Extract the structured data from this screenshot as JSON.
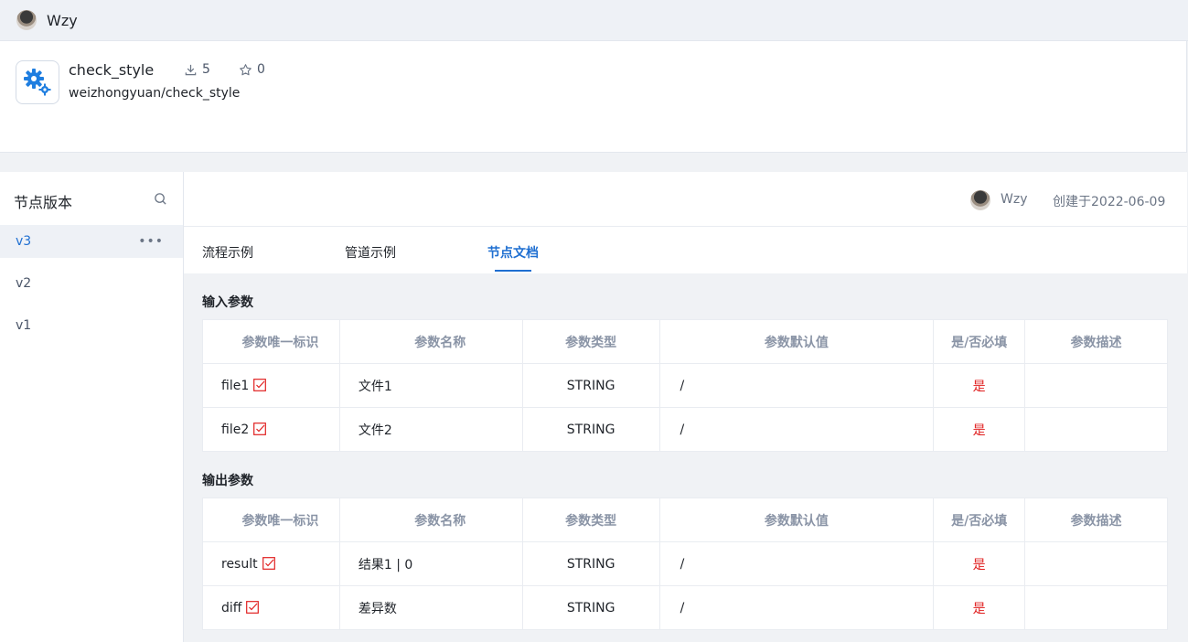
{
  "topbar": {
    "user_name": "Wzy"
  },
  "node": {
    "name": "check_style",
    "path": "weizhongyuan/check_style",
    "downloads": "5",
    "stars": "0",
    "icon": "gear-icon"
  },
  "sidebar": {
    "title": "节点版本",
    "versions": [
      {
        "label": "v3",
        "active": true
      },
      {
        "label": "v2"
      },
      {
        "label": "v1"
      }
    ]
  },
  "meta": {
    "user": "Wzy",
    "created": "创建于2022-06-09"
  },
  "tabs": [
    {
      "label": "流程示例"
    },
    {
      "label": "管道示例"
    },
    {
      "label": "节点文档",
      "active": true
    }
  ],
  "columns": [
    "参数唯一标识",
    "参数名称",
    "参数类型",
    "参数默认值",
    "是/否必填",
    "参数描述"
  ],
  "inputs": {
    "title": "输入参数",
    "rows": [
      {
        "key": "file1",
        "name": "文件1",
        "type": "STRING",
        "default": "/",
        "required": "是",
        "desc": ""
      },
      {
        "key": "file2",
        "name": "文件2",
        "type": "STRING",
        "default": "/",
        "required": "是",
        "desc": ""
      }
    ]
  },
  "outputs": {
    "title": "输出参数",
    "rows": [
      {
        "key": "result",
        "name": "结果1 | 0",
        "type": "STRING",
        "default": "/",
        "required": "是",
        "desc": ""
      },
      {
        "key": "diff",
        "name": "差异数",
        "type": "STRING",
        "default": "/",
        "required": "是",
        "desc": ""
      }
    ]
  },
  "colors": {
    "accent": "#1f6fd1",
    "required": "#e02020",
    "check": "#e02020"
  }
}
